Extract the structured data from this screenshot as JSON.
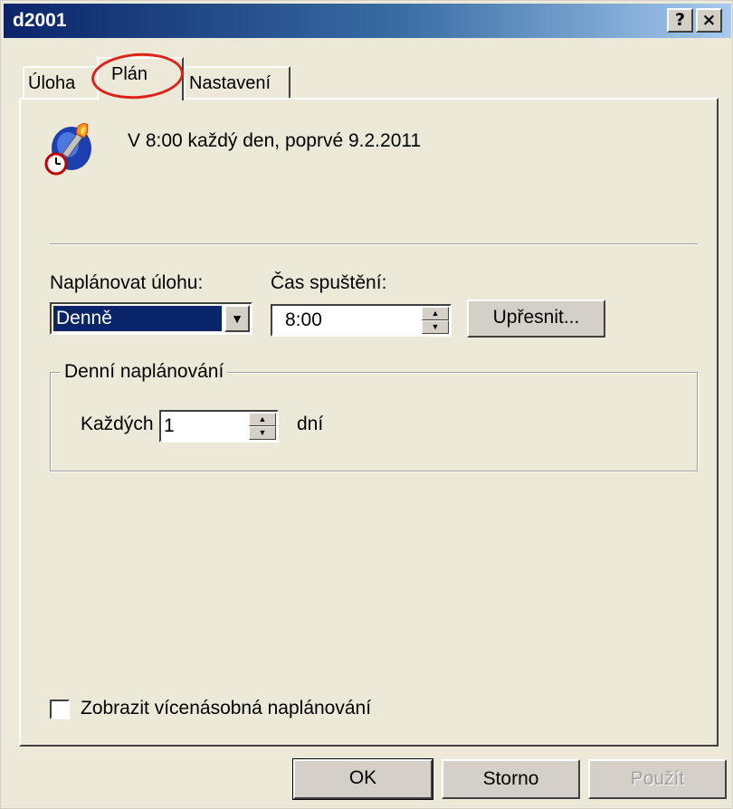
{
  "window": {
    "title": "d2001",
    "help_button": "?",
    "close_button": "×"
  },
  "tabs": [
    {
      "label": "Úloha"
    },
    {
      "label": "Plán"
    },
    {
      "label": "Nastavení"
    }
  ],
  "schedule_summary": "V 8:00 každý den, poprvé 9.2.2011",
  "schedule_task": {
    "label": "Naplánovat úlohu:",
    "value": "Denně"
  },
  "start_time": {
    "label": "Čas spuštění:",
    "value": "8:00"
  },
  "advanced_button": "Upřesnit...",
  "daily_group": {
    "title": "Denní naplánování",
    "every_label": "Každých",
    "every_value": "1",
    "days_label": "dní"
  },
  "show_multiple": {
    "label": "Zobrazit vícenásobná naplánování",
    "checked": false
  },
  "buttons": {
    "ok": "OK",
    "cancel": "Storno",
    "apply": "Použít"
  },
  "colors": {
    "annotation_circle": "#e0211a",
    "selection": "#0a246a"
  },
  "icons": [
    "torch-schedule-icon",
    "clock-icon",
    "help-icon",
    "close-icon",
    "dropdown-arrow-icon",
    "spin-up-icon",
    "spin-down-icon"
  ]
}
